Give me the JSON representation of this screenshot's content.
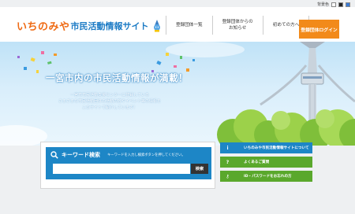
{
  "utility": {
    "bg_color_label": "背景色"
  },
  "header": {
    "logo_main": "いちのみや",
    "logo_sub": "市民活動情報サイト",
    "nav": [
      {
        "label": "登録団体一覧"
      },
      {
        "label": "登録団体からの\nお知らせ"
      },
      {
        "label": "初めての方へ"
      }
    ],
    "login_label": "登録団体ログイン"
  },
  "hero": {
    "title": "一宮市内の市民活動情報が満載！",
    "desc_lines": [
      "一宮市市民活動支援センターに登録している",
      "さまざまな市民活動団体の活動内容やイベント等の情報を",
      "このサイトで紹介しています！"
    ]
  },
  "search": {
    "title": "キーワード検索",
    "hint": "キーワードを入力し検索ボタンを押してください。",
    "input_value": "",
    "button_label": "検索"
  },
  "links": [
    {
      "label": "いちのみや市民活動情報サイトについて",
      "icon": "info-icon",
      "color": "#1d86c6"
    },
    {
      "label": "よくあるご質問",
      "icon": "question-icon",
      "color": "#5aa82c"
    },
    {
      "label": "ID・パスワードをお忘れの方",
      "icon": "key-icon",
      "color": "#5aa82c"
    }
  ],
  "colors": {
    "accent_orange": "#f28a1a",
    "brand_blue": "#1d86c6",
    "brand_green": "#5aa82c"
  }
}
